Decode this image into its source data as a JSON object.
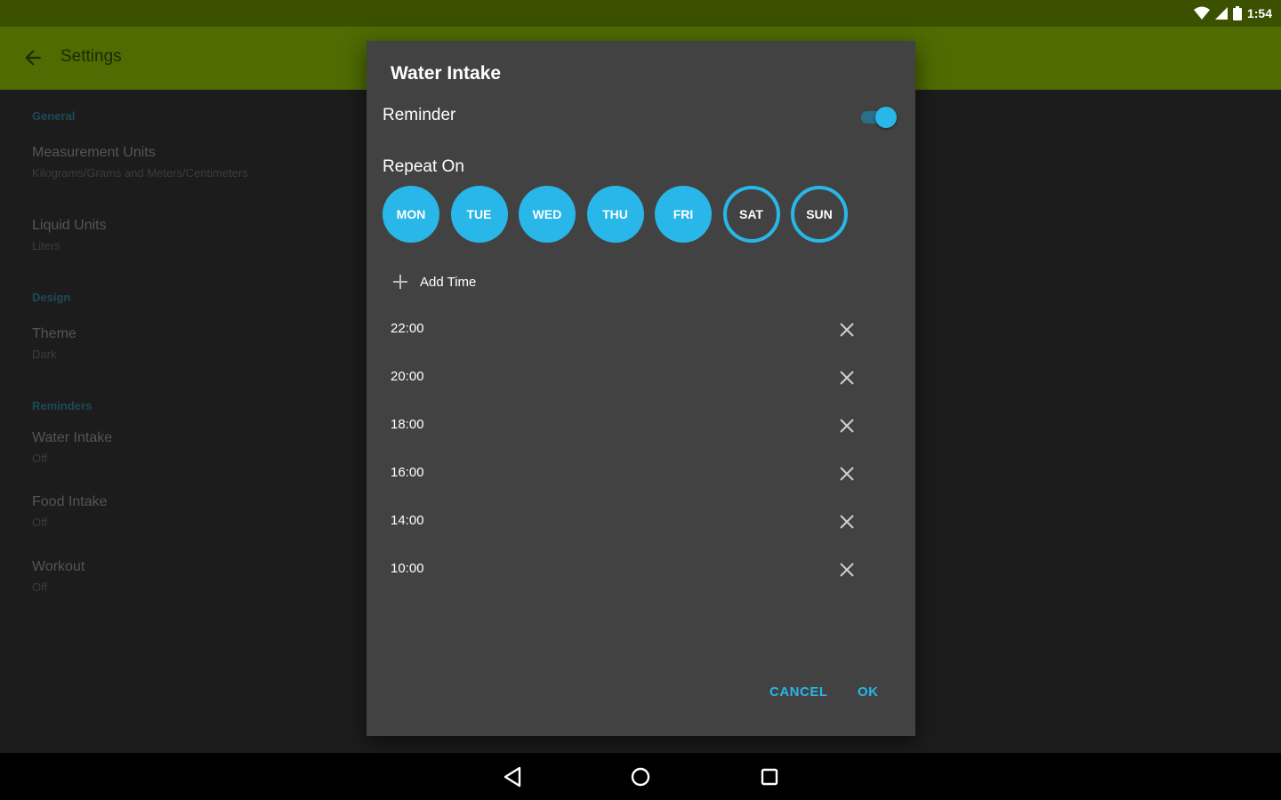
{
  "status_bar": {
    "time": "1:54",
    "icons": [
      "wifi-icon",
      "signal-icon",
      "battery-icon"
    ]
  },
  "app_bar": {
    "title": "Settings",
    "back_icon": "arrow-back-icon"
  },
  "settings": {
    "general": {
      "header": "General",
      "measurement_units": {
        "title": "Measurement Units",
        "summary": "Kilograms/Grams and Meters/Centimeters"
      },
      "liquid_units": {
        "title": "Liquid Units",
        "summary": "Liters"
      }
    },
    "design": {
      "header": "Design",
      "theme": {
        "title": "Theme",
        "summary": "Dark"
      }
    },
    "reminders": {
      "header": "Reminders",
      "water_intake": {
        "title": "Water Intake",
        "summary": "Off"
      },
      "food_intake": {
        "title": "Food Intake",
        "summary": "Off"
      },
      "workout": {
        "title": "Workout",
        "summary": "Off"
      }
    }
  },
  "dialog": {
    "title": "Water Intake",
    "reminder_label": "Reminder",
    "reminder_enabled": true,
    "repeat_label": "Repeat On",
    "days": [
      {
        "label": "MON",
        "selected": true
      },
      {
        "label": "TUE",
        "selected": true
      },
      {
        "label": "WED",
        "selected": true
      },
      {
        "label": "THU",
        "selected": true
      },
      {
        "label": "FRI",
        "selected": true
      },
      {
        "label": "SAT",
        "selected": false
      },
      {
        "label": "SUN",
        "selected": false
      }
    ],
    "add_time_label": "Add Time",
    "times": [
      "22:00",
      "20:00",
      "18:00",
      "16:00",
      "14:00",
      "10:00"
    ],
    "cancel_label": "CANCEL",
    "ok_label": "OK"
  },
  "colors": {
    "accent": "#29b6e8",
    "status_bar": "#3b5100",
    "app_bar_dimmed": "#4f6b02",
    "dialog_bg": "#424242",
    "background": "#1c1c1c"
  }
}
